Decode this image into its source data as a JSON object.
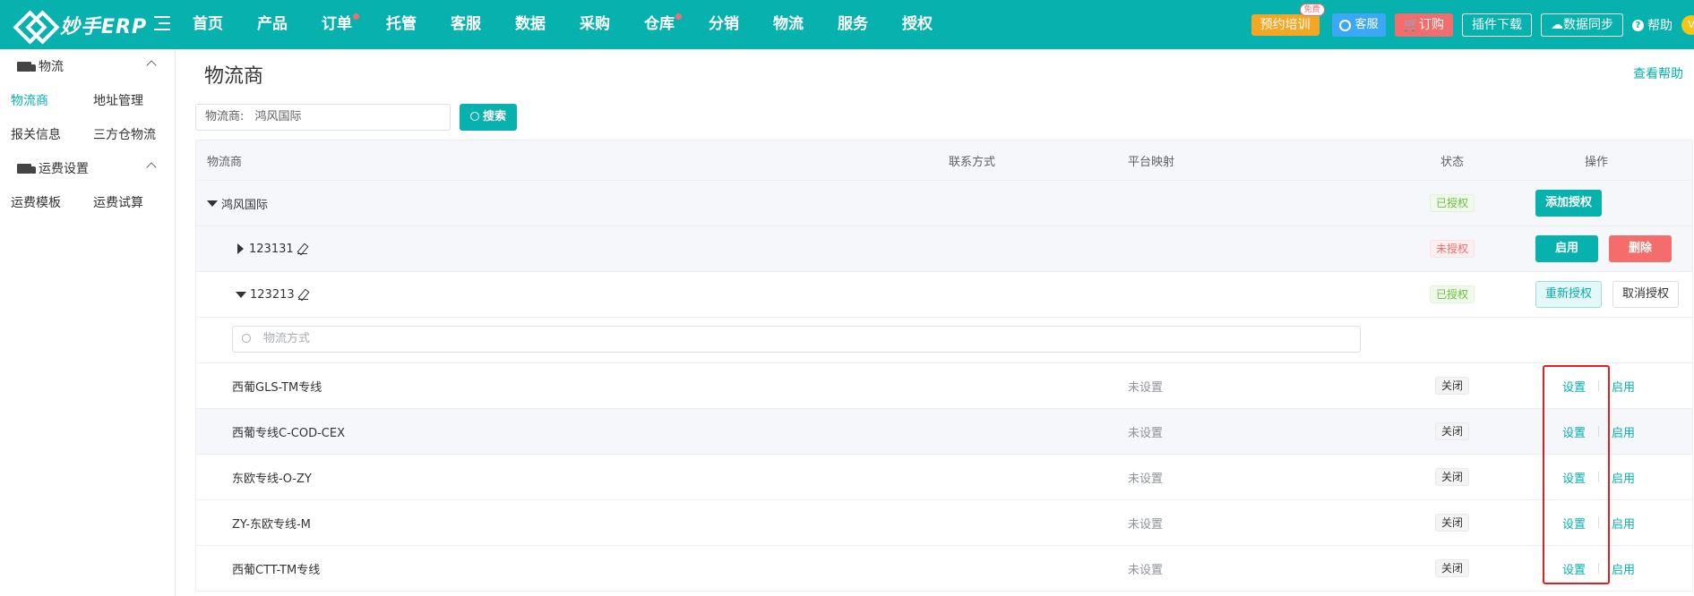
{
  "header": {
    "logo_text": "妙手ERP",
    "nav": [
      {
        "label": "首页",
        "dot": false
      },
      {
        "label": "产品",
        "dot": false
      },
      {
        "label": "订单",
        "dot": true
      },
      {
        "label": "托管",
        "dot": false
      },
      {
        "label": "客服",
        "dot": false
      },
      {
        "label": "数据",
        "dot": false
      },
      {
        "label": "采购",
        "dot": false
      },
      {
        "label": "仓库",
        "dot": true
      },
      {
        "label": "分销",
        "dot": false
      },
      {
        "label": "物流",
        "dot": false
      },
      {
        "label": "服务",
        "dot": false
      },
      {
        "label": "授权",
        "dot": false
      }
    ],
    "training_label": "预约培训",
    "free_badge": "免费",
    "kefu_label": "客服",
    "order_label": "订购",
    "plugin_label": "插件下载",
    "sync_label": "数据同步",
    "help_label": "帮助",
    "avatar_letter": "V"
  },
  "sidebar": {
    "group1": "物流",
    "row1": [
      "物流商",
      "地址管理"
    ],
    "row2": [
      "报关信息",
      "三方仓物流"
    ],
    "group2": "运费设置",
    "row3": [
      "运费模板",
      "运费试算"
    ]
  },
  "main": {
    "title": "物流商",
    "help_link": "查看帮助",
    "search_label": "物流商:",
    "search_value": "鸿风国际",
    "search_button": "搜索"
  },
  "table": {
    "headers": {
      "name": "物流商",
      "contact": "联系方式",
      "mapping": "平台映射",
      "status": "状态",
      "ops": "操作"
    },
    "provider": {
      "name": "鸿风国际",
      "status": "已授权",
      "add_auth": "添加授权"
    },
    "account1": {
      "name": "123131",
      "status": "未授权",
      "enable": "启用",
      "delete": "删除"
    },
    "account2": {
      "name": "123213",
      "status": "已授权",
      "reauth": "重新授权",
      "cancel_auth": "取消授权"
    },
    "method_placeholder": "物流方式",
    "methods": [
      {
        "name": "西葡GLS-TM专线",
        "mapping": "未设置",
        "status": "关闭",
        "set": "设置",
        "enable": "启用"
      },
      {
        "name": "西葡专线C-COD-CEX",
        "mapping": "未设置",
        "status": "关闭",
        "set": "设置",
        "enable": "启用"
      },
      {
        "name": "东欧专线-O-ZY",
        "mapping": "未设置",
        "status": "关闭",
        "set": "设置",
        "enable": "启用"
      },
      {
        "name": "ZY-东欧专线-M",
        "mapping": "未设置",
        "status": "关闭",
        "set": "设置",
        "enable": "启用"
      },
      {
        "name": "西葡CTT-TM专线",
        "mapping": "未设置",
        "status": "关闭",
        "set": "设置",
        "enable": "启用"
      }
    ]
  },
  "colors": {
    "primary": "#06b1ae",
    "danger": "#f56c6c",
    "success": "#67c23a",
    "highlight": "#e02020"
  }
}
